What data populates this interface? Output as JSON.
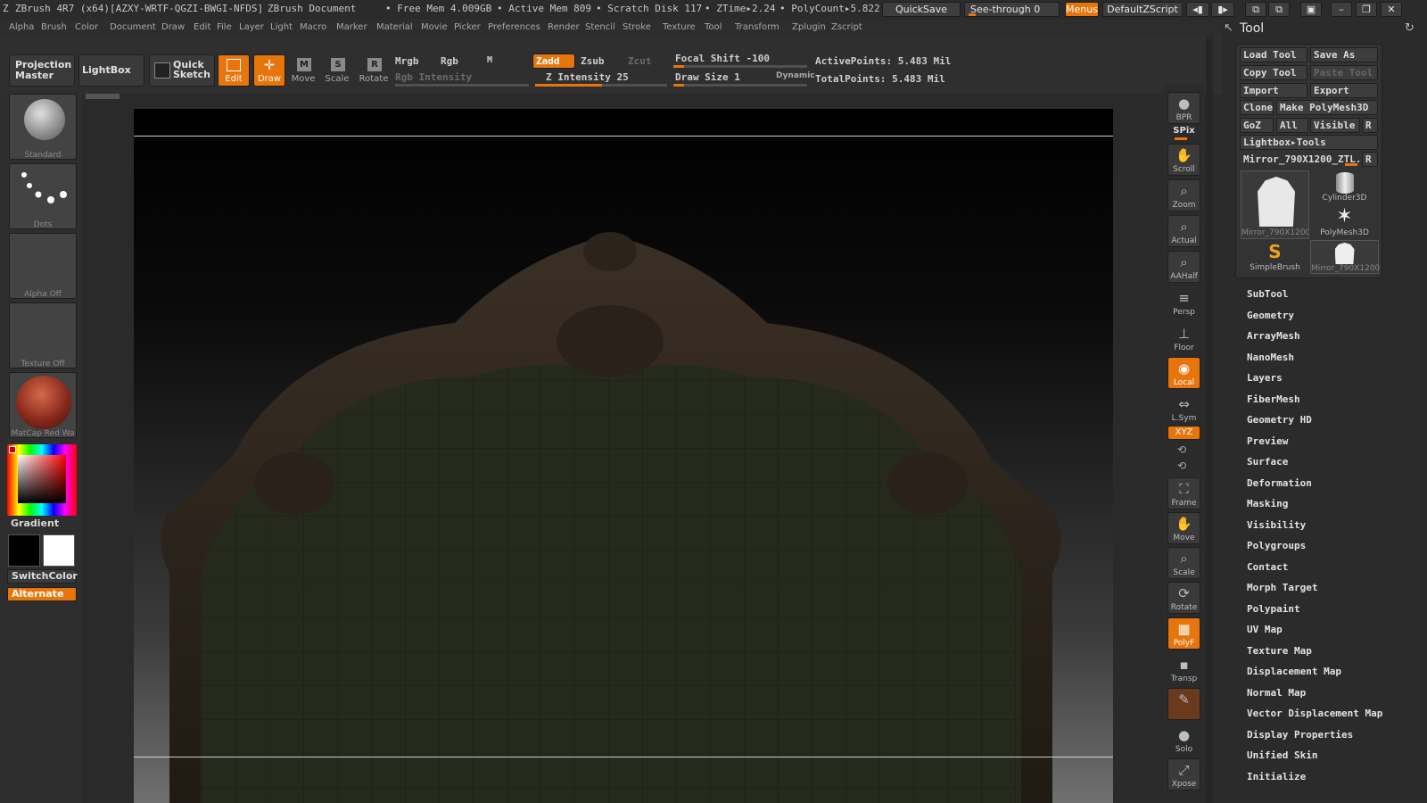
{
  "titlebar": {
    "app": "ZBrush 4R7 (x64)[AZXY-WRTF-QGZI-BWGI-NFDS]",
    "document": "ZBrush Document",
    "free_mem": "• Free Mem 4.009GB",
    "active_mem": "• Active Mem 809",
    "scratch": "• Scratch Disk 117",
    "ztime": "• ZTime▸2.24",
    "polycount": "• PolyCount▸5.822",
    "quicksave": "QuickSave",
    "see_through": "See-through  0",
    "menus": "Menus",
    "zscript": "DefaultZScript"
  },
  "menubar": [
    "Alpha",
    "Brush",
    "Color",
    "Document",
    "Draw",
    "Edit",
    "File",
    "Layer",
    "Light",
    "Macro",
    "Marker",
    "Material",
    "Movie",
    "Picker",
    "Preferences",
    "Render",
    "Stencil",
    "Stroke",
    "Texture",
    "Tool",
    "Transform",
    "Zplugin",
    "Zscript"
  ],
  "toolbar": {
    "projection_master": "Projection Master",
    "lightbox": "LightBox",
    "quick_sketch": "Quick Sketch",
    "edit": "Edit",
    "draw": "Draw",
    "move": "Move",
    "scale": "Scale",
    "rotate": "Rotate",
    "mrgb": "Mrgb",
    "rgb": "Rgb",
    "m": "M",
    "rgb_intensity": "Rgb Intensity",
    "zadd": "Zadd",
    "zsub": "Zsub",
    "zcut": "Zcut",
    "z_intensity": "Z Intensity 25",
    "focal_shift": "Focal Shift -100",
    "draw_size": "Draw Size 1",
    "dynamic": "Dynamic",
    "active_points": "ActivePoints: 5.483 Mil",
    "total_points": "TotalPoints: 5.483 Mil"
  },
  "leftshelf": {
    "brush": "Standard",
    "stroke": "Dots",
    "alpha": "Alpha Off",
    "texture": "Texture Off",
    "material": "MatCap Red Wa",
    "gradient": "Gradient",
    "switchcolor": "SwitchColor",
    "alternate": "Alternate"
  },
  "rightshelf": [
    {
      "label": "BPR",
      "icon": "●"
    },
    {
      "label": "SPix",
      "icon": ""
    },
    {
      "label": "Scroll",
      "icon": "✋"
    },
    {
      "label": "Zoom",
      "icon": "⌕"
    },
    {
      "label": "Actual",
      "icon": "⌕"
    },
    {
      "label": "AAHalf",
      "icon": "⌕"
    },
    {
      "label": "Persp",
      "icon": "≡"
    },
    {
      "label": "Floor",
      "icon": "⊥"
    },
    {
      "label": "Local",
      "icon": "◉"
    },
    {
      "label": "L.Sym",
      "icon": "⇔"
    },
    {
      "label": "XYZ",
      "icon": ""
    },
    {
      "label": "Frame",
      "icon": "⛶"
    },
    {
      "label": "Move",
      "icon": "✋"
    },
    {
      "label": "Scale",
      "icon": "⌕"
    },
    {
      "label": "Rotate",
      "icon": "⟳"
    },
    {
      "label": "PolyF",
      "icon": "▦"
    },
    {
      "label": "Transp",
      "icon": "▪"
    },
    {
      "label": "Solo",
      "icon": "●"
    },
    {
      "label": "Xpose",
      "icon": "⤢"
    }
  ],
  "tool": {
    "title": "Tool",
    "load_tool": "Load Tool",
    "save_as": "Save As",
    "copy_tool": "Copy Tool",
    "paste_tool": "Paste Tool",
    "import": "Import",
    "export": "Export",
    "clone": "Clone",
    "make_polymesh": "Make PolyMesh3D",
    "goz": "GoZ",
    "all": "All",
    "visible": "Visible",
    "r": "R",
    "lightbox_tools": "Lightbox▸Tools",
    "current_tool": "Mirror_790X1200_ZTL.",
    "thumbs": [
      "Mirror_790X1200",
      "Cylinder3D",
      "PolyMesh3D",
      "SimpleBrush",
      "Mirror_790X1200"
    ],
    "subpalettes": [
      "SubTool",
      "Geometry",
      "ArrayMesh",
      "NanoMesh",
      "Layers",
      "FiberMesh",
      "Geometry HD",
      "Preview",
      "Surface",
      "Deformation",
      "Masking",
      "Visibility",
      "Polygroups",
      "Contact",
      "Morph Target",
      "Polypaint",
      "UV Map",
      "Texture Map",
      "Displacement Map",
      "Normal Map",
      "Vector Displacement Map",
      "Display Properties",
      "Unified Skin",
      "Initialize"
    ]
  },
  "colors": {
    "accent": "#e8750b",
    "bg": "#2a2a2a",
    "panel": "#3a3a3a"
  }
}
